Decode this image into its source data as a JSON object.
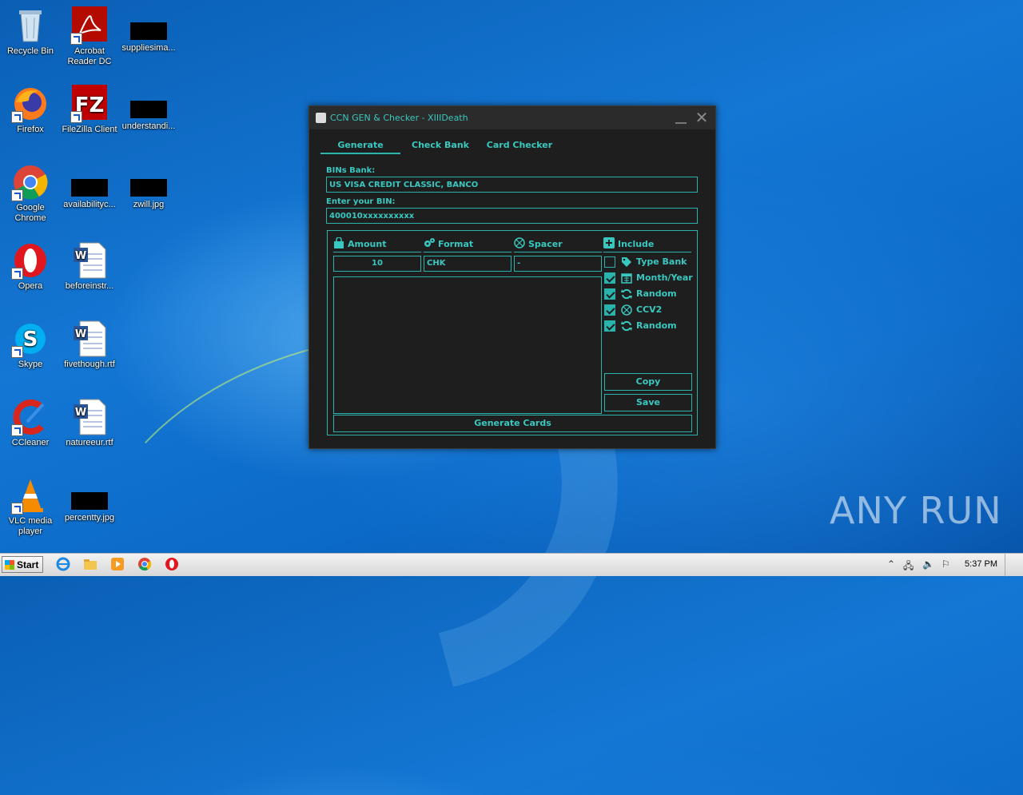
{
  "desktop": {
    "icons": [
      {
        "label": "Recycle Bin"
      },
      {
        "label": "Acrobat Reader DC"
      },
      {
        "label": "suppliesima..."
      },
      {
        "label": "Firefox"
      },
      {
        "label": "FileZilla Client"
      },
      {
        "label": "understandi..."
      },
      {
        "label": "Google Chrome"
      },
      {
        "label": "availabilityc..."
      },
      {
        "label": "zwill.jpg"
      },
      {
        "label": "Opera"
      },
      {
        "label": "beforeinstr..."
      },
      {
        "label": "Skype"
      },
      {
        "label": "fivethough.rtf"
      },
      {
        "label": "CCleaner"
      },
      {
        "label": "natureeur.rtf"
      },
      {
        "label": "VLC media player"
      },
      {
        "label": "percentty.jpg"
      }
    ],
    "watermark": "ANY RUN"
  },
  "app": {
    "title": "CCN GEN & Checker - XIIIDeath",
    "tabs": [
      {
        "label": "Generate",
        "active": true
      },
      {
        "label": "Check Bank"
      },
      {
        "label": "Card Checker"
      }
    ],
    "bins_bank_label": "BINs Bank:",
    "bins_bank_value": "US VISA CREDIT CLASSIC, BANCO",
    "bin_label": "Enter your BIN:",
    "bin_value": "400010xxxxxxxxxx",
    "columns": {
      "amount": "Amount",
      "format": "Format",
      "spacer": "Spacer",
      "include": "Include"
    },
    "amount_value": "10",
    "format_value": "CHK",
    "spacer_value": "-",
    "include_options": [
      {
        "label": "Type Bank",
        "checked": false,
        "icon": "tag-icon"
      },
      {
        "label": "Month/Year",
        "checked": true,
        "icon": "calendar-icon"
      },
      {
        "label": "Random",
        "checked": true,
        "icon": "refresh-icon"
      },
      {
        "label": "CCV2",
        "checked": true,
        "icon": "network-icon"
      },
      {
        "label": "Random",
        "checked": true,
        "icon": "refresh-icon"
      }
    ],
    "copy_label": "Copy",
    "save_label": "Save",
    "generate_label": "Generate Cards",
    "accent_color": "#39c8c0"
  },
  "taskbar": {
    "start_label": "Start",
    "clock": "5:37 PM"
  }
}
